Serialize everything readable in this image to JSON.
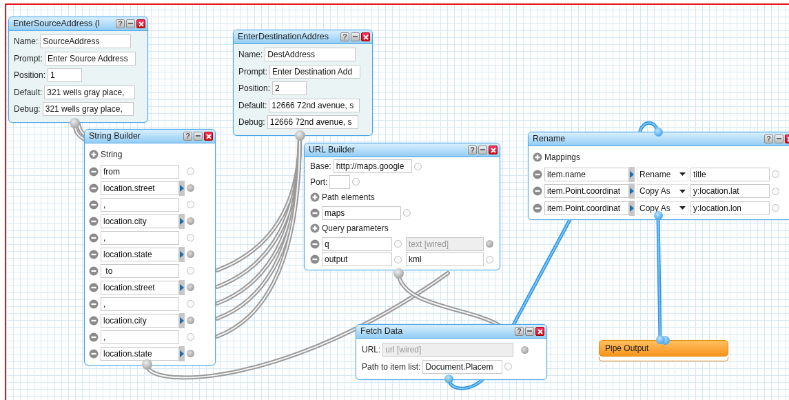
{
  "modules": [
    {
      "kind": "input",
      "title": "EnterSourceAddress (l",
      "help": "?",
      "fields": [
        {
          "label": "Name:",
          "value": "SourceAddress"
        },
        {
          "label": "Prompt:",
          "value": "Enter Source Address"
        },
        {
          "label": "Position:",
          "value": "1"
        },
        {
          "label": "Default:",
          "value": "321 wells gray place,"
        },
        {
          "label": "Debug:",
          "value": "321 wells gray place,"
        }
      ]
    },
    {
      "kind": "input",
      "title": "EnterDestinationAddres",
      "help": "?",
      "fields": [
        {
          "label": "Name:",
          "value": "DestAddress"
        },
        {
          "label": "Prompt:",
          "value": "Enter Destination Add"
        },
        {
          "label": "Position:",
          "value": "2"
        },
        {
          "label": "Default:",
          "value": "12666 72nd avenue, s"
        },
        {
          "label": "Debug:",
          "value": "12666 72nd avenue, s"
        }
      ]
    },
    {
      "kind": "string",
      "title": "String Builder",
      "help": "?",
      "heading": "String",
      "items": [
        {
          "value": "from",
          "wired": false
        },
        {
          "value": "location.street",
          "wired": true
        },
        {
          "value": ",",
          "wired": false
        },
        {
          "value": "location.city",
          "wired": true
        },
        {
          "value": ",",
          "wired": false
        },
        {
          "value": "location.state",
          "wired": true
        },
        {
          "value": " to",
          "wired": false
        },
        {
          "value": "location.street",
          "wired": true
        },
        {
          "value": ",",
          "wired": false
        },
        {
          "value": "location.city",
          "wired": true
        },
        {
          "value": ",",
          "wired": false
        },
        {
          "value": "location.state",
          "wired": true
        }
      ]
    },
    {
      "kind": "url",
      "title": "URL Builder",
      "help": "?",
      "base_label": "Base:",
      "base": "http://maps.google",
      "port_label": "Port:",
      "path_heading": "Path elements",
      "path": [
        "maps"
      ],
      "query_heading": "Query parameters",
      "query": [
        {
          "key": "q",
          "value": "text [wired]",
          "disabled": true
        },
        {
          "key": "output",
          "value": "kml",
          "disabled": false
        }
      ]
    },
    {
      "kind": "fetch",
      "title": "Fetch Data",
      "help": "?",
      "fields": [
        {
          "label": "URL:",
          "value": "url [wired]",
          "disabled": true
        },
        {
          "label": "Path to item list:",
          "value": "Document.Placem",
          "disabled": false
        }
      ]
    },
    {
      "kind": "rename",
      "title": "Rename",
      "help": "?",
      "heading": "Mappings",
      "mappings": [
        {
          "source": "item.name",
          "op": "Rename",
          "target": "title"
        },
        {
          "source": "item.Point.coordinat",
          "op": "Copy As",
          "target": "y:location.lat"
        },
        {
          "source": "item.Point.coordinat",
          "op": "Copy As",
          "target": "y:location.lon"
        }
      ]
    },
    {
      "kind": "output",
      "title": "Pipe Output"
    }
  ]
}
